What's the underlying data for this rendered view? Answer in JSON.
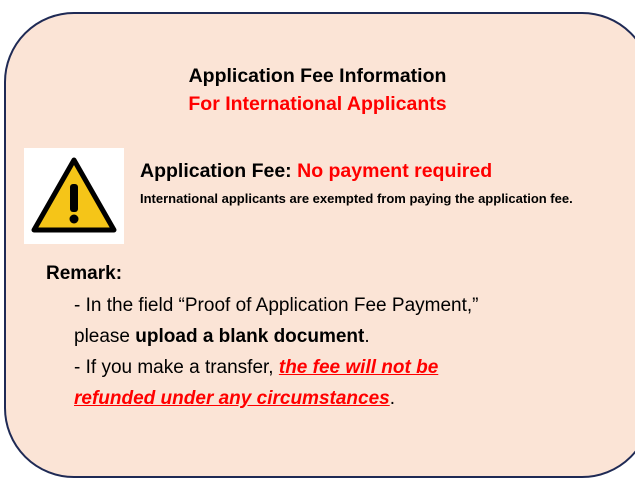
{
  "notice": {
    "title": "Application Fee Information",
    "subtitle": "For International Applicants",
    "fee_label": "Application Fee:",
    "fee_value": "No payment required",
    "fee_description": "International applicants are exempted from paying the application fee.",
    "warning_icon": "warning-triangle-icon",
    "remark_label": "Remark:",
    "remark_1_prefix": "- In the field “Proof of Application Fee Payment,”",
    "remark_1_cont": "please ",
    "remark_1_bold": "upload a blank document",
    "remark_1_end": ".",
    "remark_2_prefix": "- If you make a transfer, ",
    "remark_2_emph_a": "the fee will not be",
    "remark_2_emph_b": "refunded under any circumstances",
    "remark_2_end": "."
  },
  "colors": {
    "background": "#fbe4d6",
    "border": "#1f2a55",
    "accent_red": "#ff0000",
    "warning_yellow": "#f5c518"
  }
}
